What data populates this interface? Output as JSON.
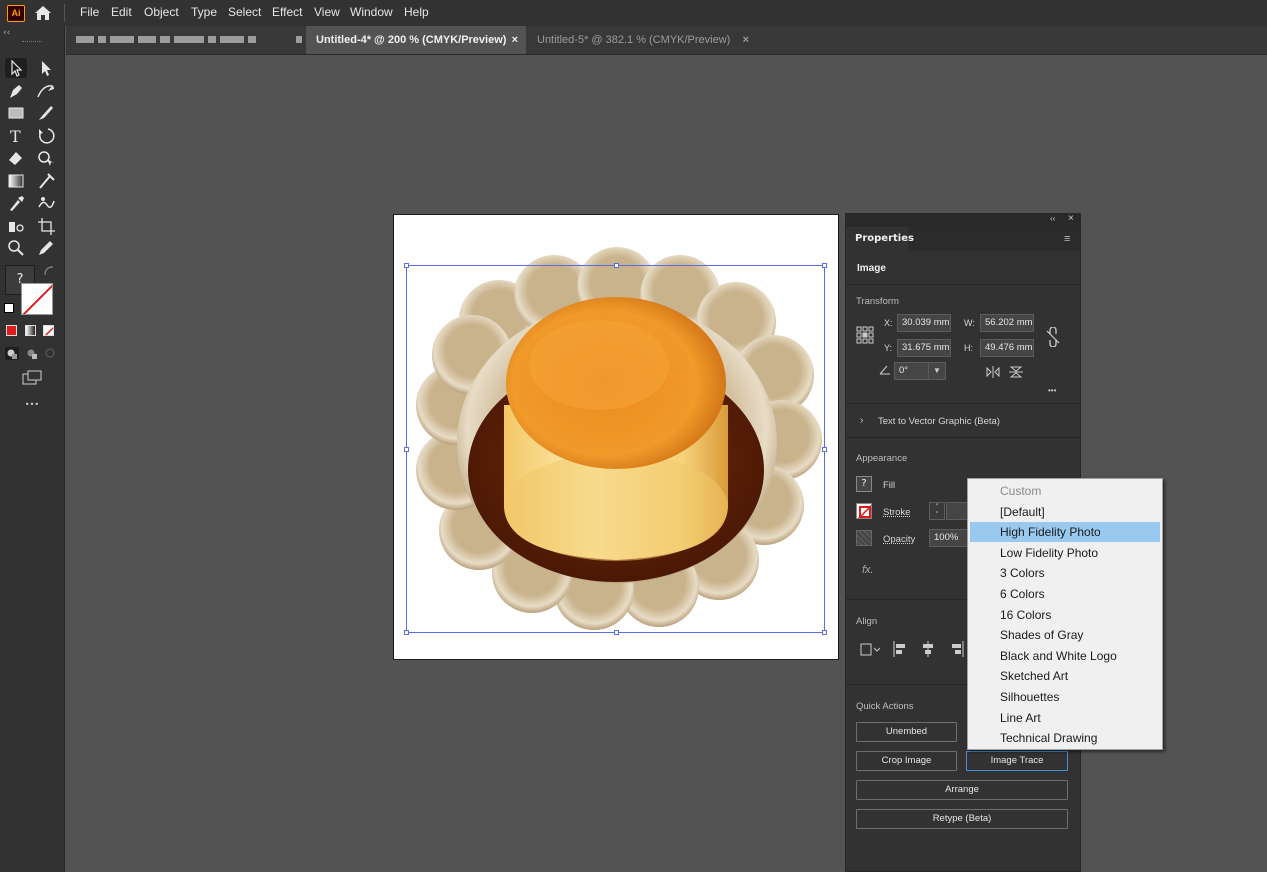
{
  "menubar": {
    "app_logo": "Ai",
    "items": [
      "File",
      "Edit",
      "Object",
      "Type",
      "Select",
      "Effect",
      "View",
      "Window",
      "Help"
    ]
  },
  "tabs": [
    {
      "label": "Untitled-4* @ 200 % (CMYK/Preview)",
      "close": "×",
      "active": true
    },
    {
      "label": "Untitled-5* @ 382.1 % (CMYK/Preview)",
      "close": "×",
      "active": false
    }
  ],
  "toolbar": {
    "collapse": "‹‹",
    "fill_unknown": "?",
    "more": "•••"
  },
  "panel": {
    "header_icons": {
      "collapse": "‹‹",
      "close": "×"
    },
    "tab": "Properties",
    "menu_icon": "≡",
    "object_type": "Image",
    "transform": {
      "heading": "Transform",
      "x_label": "X:",
      "x_value": "30.039 mm",
      "y_label": "Y:",
      "y_value": "31.675 mm",
      "w_label": "W:",
      "w_value": "56.202 mm",
      "h_label": "H:",
      "h_value": "49.476 mm",
      "angle_value": "0°",
      "more": "•••"
    },
    "text_to_vector": "Text to Vector Graphic (Beta)",
    "appearance": {
      "heading": "Appearance",
      "fill_icon": "?",
      "fill": "Fill",
      "stroke": "Stroke",
      "opacity": "Opacity",
      "opacity_value": "100%",
      "fx": "fx."
    },
    "align": {
      "heading": "Align"
    },
    "quick_actions": {
      "heading": "Quick Actions",
      "unembed": "Unembed",
      "crop_image": "Crop Image",
      "image_trace": "Image Trace",
      "arrange": "Arrange",
      "retype": "Retype (Beta)"
    }
  },
  "dropdown": {
    "items": [
      {
        "label": "Custom",
        "state": "disabled"
      },
      {
        "label": "[Default]",
        "state": "normal"
      },
      {
        "label": "High Fidelity Photo",
        "state": "selected"
      },
      {
        "label": "Low Fidelity Photo",
        "state": "normal"
      },
      {
        "label": "3 Colors",
        "state": "normal"
      },
      {
        "label": "6 Colors",
        "state": "normal"
      },
      {
        "label": "16 Colors",
        "state": "normal"
      },
      {
        "label": "Shades of Gray",
        "state": "normal"
      },
      {
        "label": "Black and White Logo",
        "state": "normal"
      },
      {
        "label": "Sketched Art",
        "state": "normal"
      },
      {
        "label": "Silhouettes",
        "state": "normal"
      },
      {
        "label": "Line Art",
        "state": "normal"
      },
      {
        "label": "Technical Drawing",
        "state": "normal"
      }
    ]
  },
  "colors": {
    "accent_highlight": "#99c9ef",
    "selection_blue": "#5b6ee1",
    "app_orange": "#ff9a00"
  }
}
